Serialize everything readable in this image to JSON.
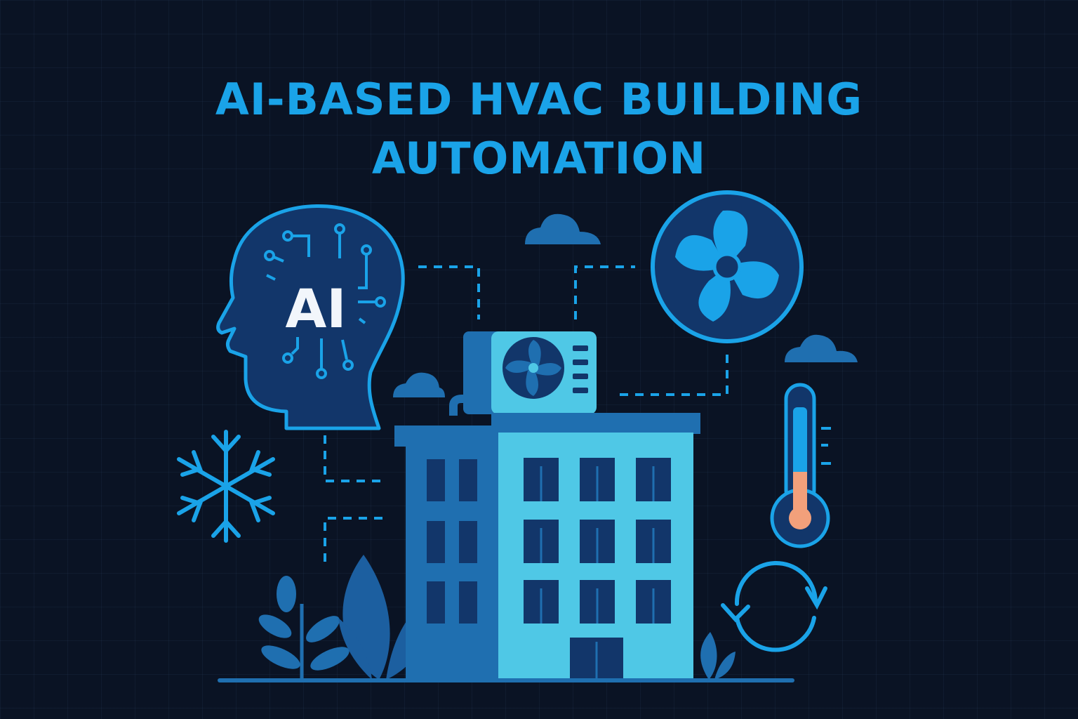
{
  "title": {
    "line1": "AI-BASED HVAC BUILDING",
    "line2": "AUTOMATION"
  },
  "head_badge": "AI",
  "icons": [
    "ai-head-icon",
    "fan-icon",
    "ac-unit-icon",
    "building-icon",
    "snowflake-icon",
    "thermometer-icon",
    "refresh-cycle-icon",
    "cloud-icon",
    "plant-icon"
  ],
  "colors": {
    "background": "#0a1324",
    "accent": "#1aa3e8",
    "light_blue": "#4fc8e6",
    "mid_blue": "#1f6fb0",
    "dark_blue": "#12366a",
    "thermometer_bulb": "#f2a07b"
  }
}
